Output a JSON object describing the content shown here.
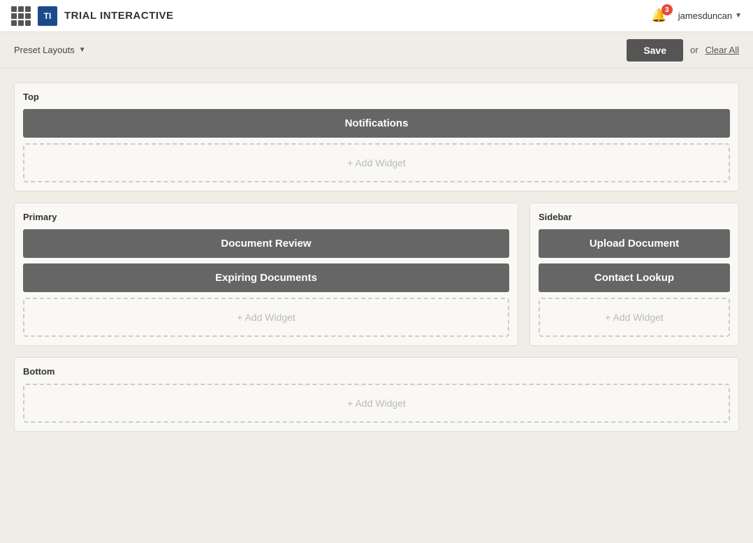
{
  "header": {
    "app_title": "TRIAL INTERACTIVE",
    "logo_text": "TI",
    "user_name": "jamesduncan",
    "notification_count": "3"
  },
  "toolbar": {
    "preset_label": "Preset Layouts",
    "save_label": "Save",
    "or_text": "or",
    "clear_all_label": "Clear All"
  },
  "sections": {
    "top": {
      "label": "Top",
      "widgets": [
        "Notifications"
      ],
      "add_widget_label": "+ Add Widget"
    },
    "primary": {
      "label": "Primary",
      "widgets": [
        "Document Review",
        "Expiring Documents"
      ],
      "add_widget_label": "+ Add Widget"
    },
    "sidebar": {
      "label": "Sidebar",
      "widgets": [
        "Upload Document",
        "Contact Lookup"
      ],
      "add_widget_label": "+ Add Widget"
    },
    "bottom": {
      "label": "Bottom",
      "widgets": [],
      "add_widget_label": "+ Add Widget"
    }
  }
}
